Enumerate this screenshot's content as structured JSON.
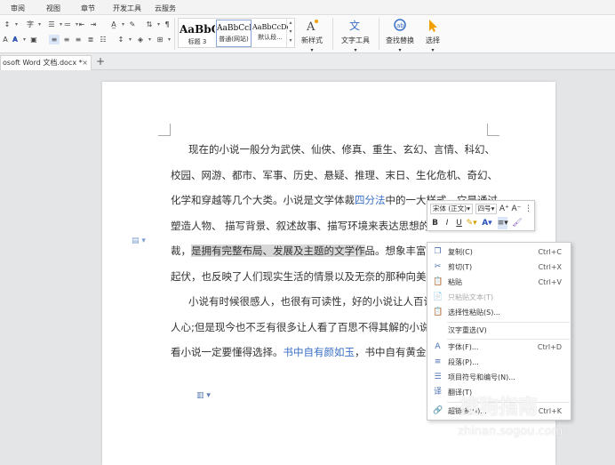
{
  "menu_tabs": [
    "审阅",
    "视图",
    "章节",
    "开发工具",
    "云服务"
  ],
  "styles": [
    {
      "preview": "AaBbC",
      "label": "标题 3"
    },
    {
      "preview": "AaBbCcD",
      "label": "普通(网站)"
    },
    {
      "preview": "AaBbCcDd",
      "label": "默认段..."
    }
  ],
  "ribbon_buttons": {
    "new_style": "新样式",
    "text_tools": "文字工具",
    "find_replace": "查找替换",
    "select": "选择"
  },
  "doc_tab": {
    "title": "osoft Word 文档.docx *",
    "close": "×",
    "new": "+"
  },
  "document": {
    "p1": {
      "t1": "现在的小说一般分为武侠、仙侠、修真、重生、玄幻、言情、科幻、校园、网游、都市、军事、历史、悬疑、推理、末日、生化危机、奇幻、化学和穿越等几个大类。小说是文学体裁",
      "link1": "四分法",
      "t2": "中的一大样式。它是通过塑造人物、 描写背景、叙述故事、描写环境来表达思想的一种文学体裁，",
      "highlight": "是拥有完整布局、发展及主题的文学作",
      "t3": "品。想象丰富，内容情节跌宕起伏，也反映了人们现实生活的情景以及无奈的那种向美好生活的渴望！"
    },
    "p2": {
      "t1": "小说有时候很感人，也很有可读性，好的小说让人百读不厌，感人动人心;但是现今也不乏有很多让人看了百思不得其解的小说。总而言之，看小说一定要懂得选择。",
      "link": "书中自有颜如玉",
      "t2": "，书中自有黄金屋。"
    }
  },
  "mini_toolbar": {
    "font": "宋体 (正文)",
    "size": "四号",
    "grow": "A⁺",
    "shrink": "A⁻",
    "bold": "B",
    "italic": "I",
    "underline": "U"
  },
  "context_menu": [
    {
      "icon": "copy-icon",
      "glyph": "❐",
      "label": "复制(C)",
      "shortcut": "Ctrl+C",
      "disabled": false
    },
    {
      "icon": "cut-icon",
      "glyph": "✂",
      "label": "剪切(T)",
      "shortcut": "Ctrl+X",
      "disabled": false
    },
    {
      "icon": "paste-icon",
      "glyph": "📋",
      "label": "粘贴",
      "shortcut": "Ctrl+V",
      "disabled": false
    },
    {
      "icon": "paste-text-icon",
      "glyph": "📄",
      "label": "只粘贴文本(T)",
      "shortcut": "",
      "disabled": true
    },
    {
      "icon": "paste-special-icon",
      "glyph": "📋",
      "label": "选择性粘贴(S)...",
      "shortcut": "",
      "disabled": false
    },
    {
      "icon": "",
      "glyph": "",
      "label": "汉字重选(V)",
      "shortcut": "",
      "disabled": false
    },
    {
      "icon": "font-icon",
      "glyph": "A",
      "label": "字体(F)...",
      "shortcut": "Ctrl+D",
      "disabled": false
    },
    {
      "icon": "paragraph-icon",
      "glyph": "≡",
      "label": "段落(P)...",
      "shortcut": "",
      "disabled": false
    },
    {
      "icon": "bullets-icon",
      "glyph": "☰",
      "label": "项目符号和编号(N)...",
      "shortcut": "",
      "disabled": false
    },
    {
      "icon": "translate-icon",
      "glyph": "译",
      "label": "翻译(T)",
      "shortcut": "",
      "disabled": false
    },
    {
      "icon": "hyperlink-icon",
      "glyph": "🔗",
      "label": "超链接(H)...",
      "shortcut": "Ctrl+K",
      "disabled": false
    }
  ],
  "watermark": {
    "cn": "搜狗指南",
    "url": "zhinan.sogou.com"
  },
  "colors": {
    "accent": "#3a6fc6",
    "selection": "#d7d7d7",
    "font_color": "#2a52be",
    "highlight_color": "#f0c000"
  }
}
